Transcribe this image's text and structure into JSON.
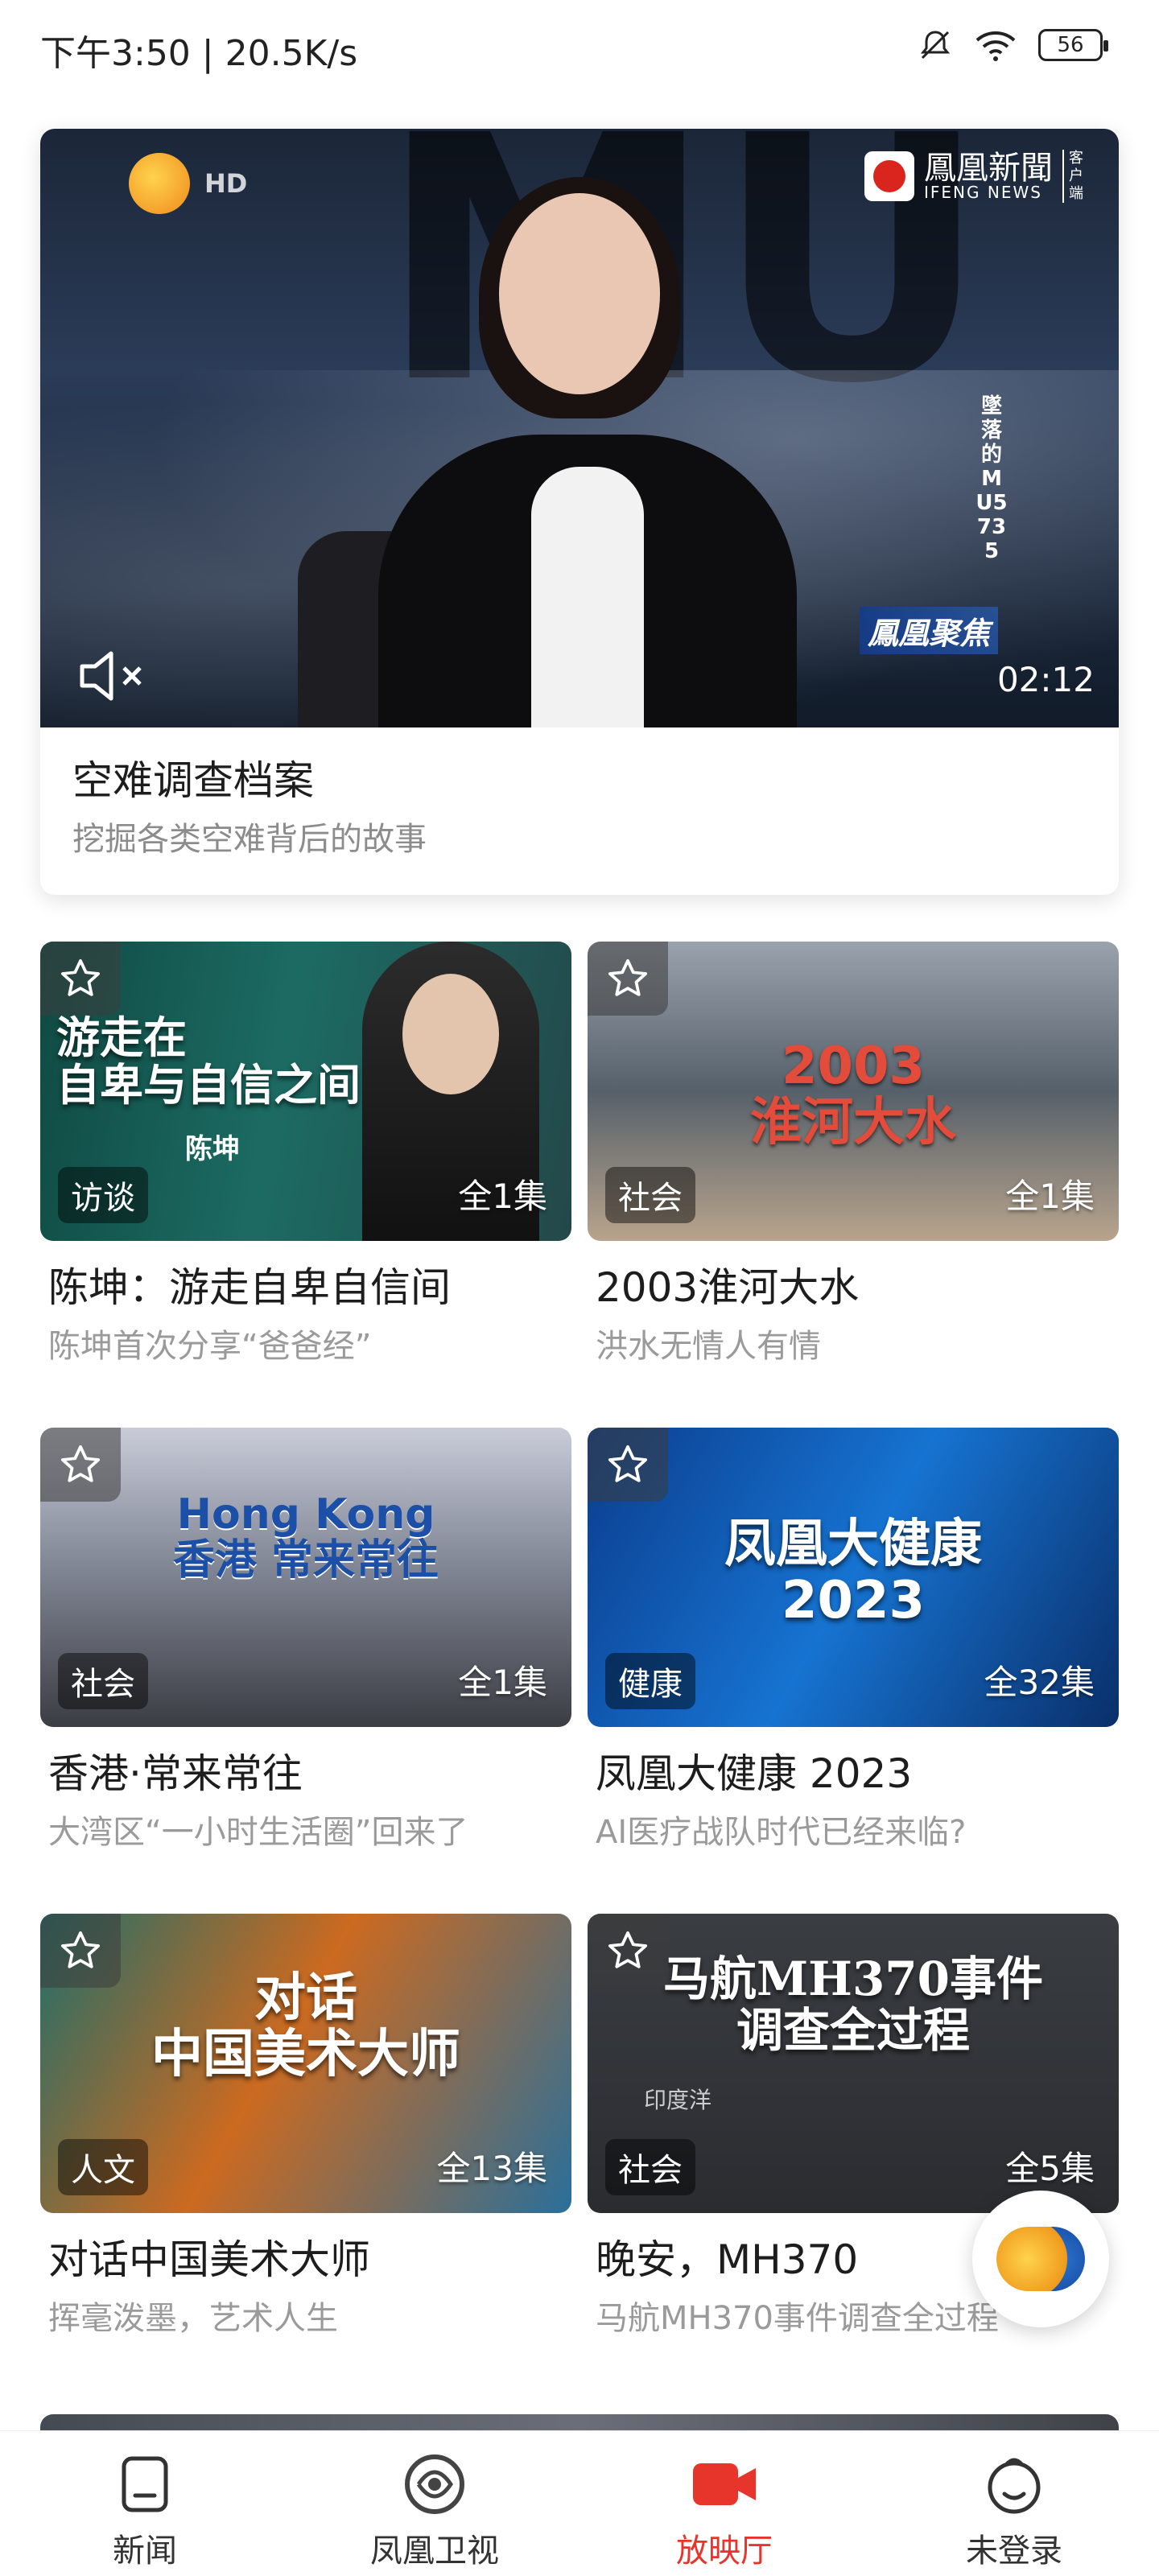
{
  "status_bar": {
    "time_speed": "下午3:50 | 20.5K/s",
    "battery": "56"
  },
  "hero": {
    "hd_label": "HD",
    "brand_cn": "鳳凰新聞",
    "brand_en": "IFENG NEWS",
    "brand_sub": "客户端",
    "vertical_title": "墜落的MU5735",
    "program_tag": "鳳凰聚焦",
    "duration": "02:12",
    "title": "空难调查档案",
    "subtitle": "挖掘各类空难背后的故事"
  },
  "cards": [
    {
      "thumb_text": "游走在\n自卑与自信之间",
      "thumb_sub": "陈坤",
      "category": "访谈",
      "episodes": "全1集",
      "title": "陈坤：游走自卑自信间",
      "subtitle": "陈坤首次分享“爸爸经”"
    },
    {
      "thumb_text": "2003\n淮河大水",
      "thumb_sub": "",
      "category": "社会",
      "episodes": "全1集",
      "title": "2003淮河大水",
      "subtitle": "洪水无情人有情"
    },
    {
      "thumb_text": "Hong Kong\n香港 常来常往",
      "thumb_sub": "",
      "category": "社会",
      "episodes": "全1集",
      "title": "香港·常来常往",
      "subtitle": "大湾区“一小时生活圈”回来了"
    },
    {
      "thumb_text": "凤凰大健康\n2023",
      "thumb_sub": "",
      "category": "健康",
      "episodes": "全32集",
      "title": "凤凰大健康 2023",
      "subtitle": "AI医疗战队时代已经来临?"
    },
    {
      "thumb_text": "对话\n中国美术大师",
      "thumb_sub": "",
      "category": "人文",
      "episodes": "全13集",
      "title": "对话中国美术大师",
      "subtitle": "挥毫泼墨，艺术人生"
    },
    {
      "thumb_text": "马航MH370事件\n调查全过程",
      "thumb_sub": "印度洋",
      "category": "社会",
      "episodes": "全5集",
      "title": "晚安，MH370",
      "subtitle": "马航MH370事件调查全过程"
    }
  ],
  "nav": [
    {
      "label": "新闻",
      "icon": "news-icon"
    },
    {
      "label": "凤凰卫视",
      "icon": "phoenix-tv-icon"
    },
    {
      "label": "放映厅",
      "icon": "video-camera-icon",
      "active": true
    },
    {
      "label": "未登录",
      "icon": "profile-icon"
    }
  ],
  "colors": {
    "accent": "#e8352c",
    "subtitle_gray": "#9a9a9a"
  }
}
